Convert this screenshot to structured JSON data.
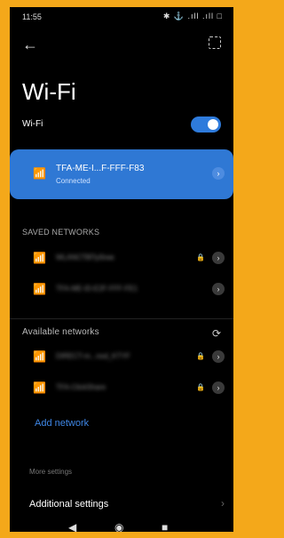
{
  "status_bar": {
    "time": "11:55",
    "icons_text": "✱ ⚓ .ıll .ıll □"
  },
  "page": {
    "title": "Wi-Fi"
  },
  "wifi_toggle": {
    "label": "Wi-Fi",
    "state": "on"
  },
  "connected_network": {
    "ssid": "TFA-ME-I...F-FFF-F83",
    "status": "Connected"
  },
  "saved_networks": {
    "header": "SAVED NETWORKS",
    "items": [
      {
        "name": "WLANСТВПублик"
      },
      {
        "name": "TFA-ME-ID-E2F-FFF-FE1"
      }
    ]
  },
  "available_networks": {
    "header": "Available networks",
    "items": [
      {
        "name": "DIRECT-m...nod_KTYF"
      },
      {
        "name": "TFA-ClickShare"
      }
    ]
  },
  "add_network": {
    "label": "Add network"
  },
  "more_settings": {
    "header": "More settings",
    "additional_label": "Additional settings"
  }
}
